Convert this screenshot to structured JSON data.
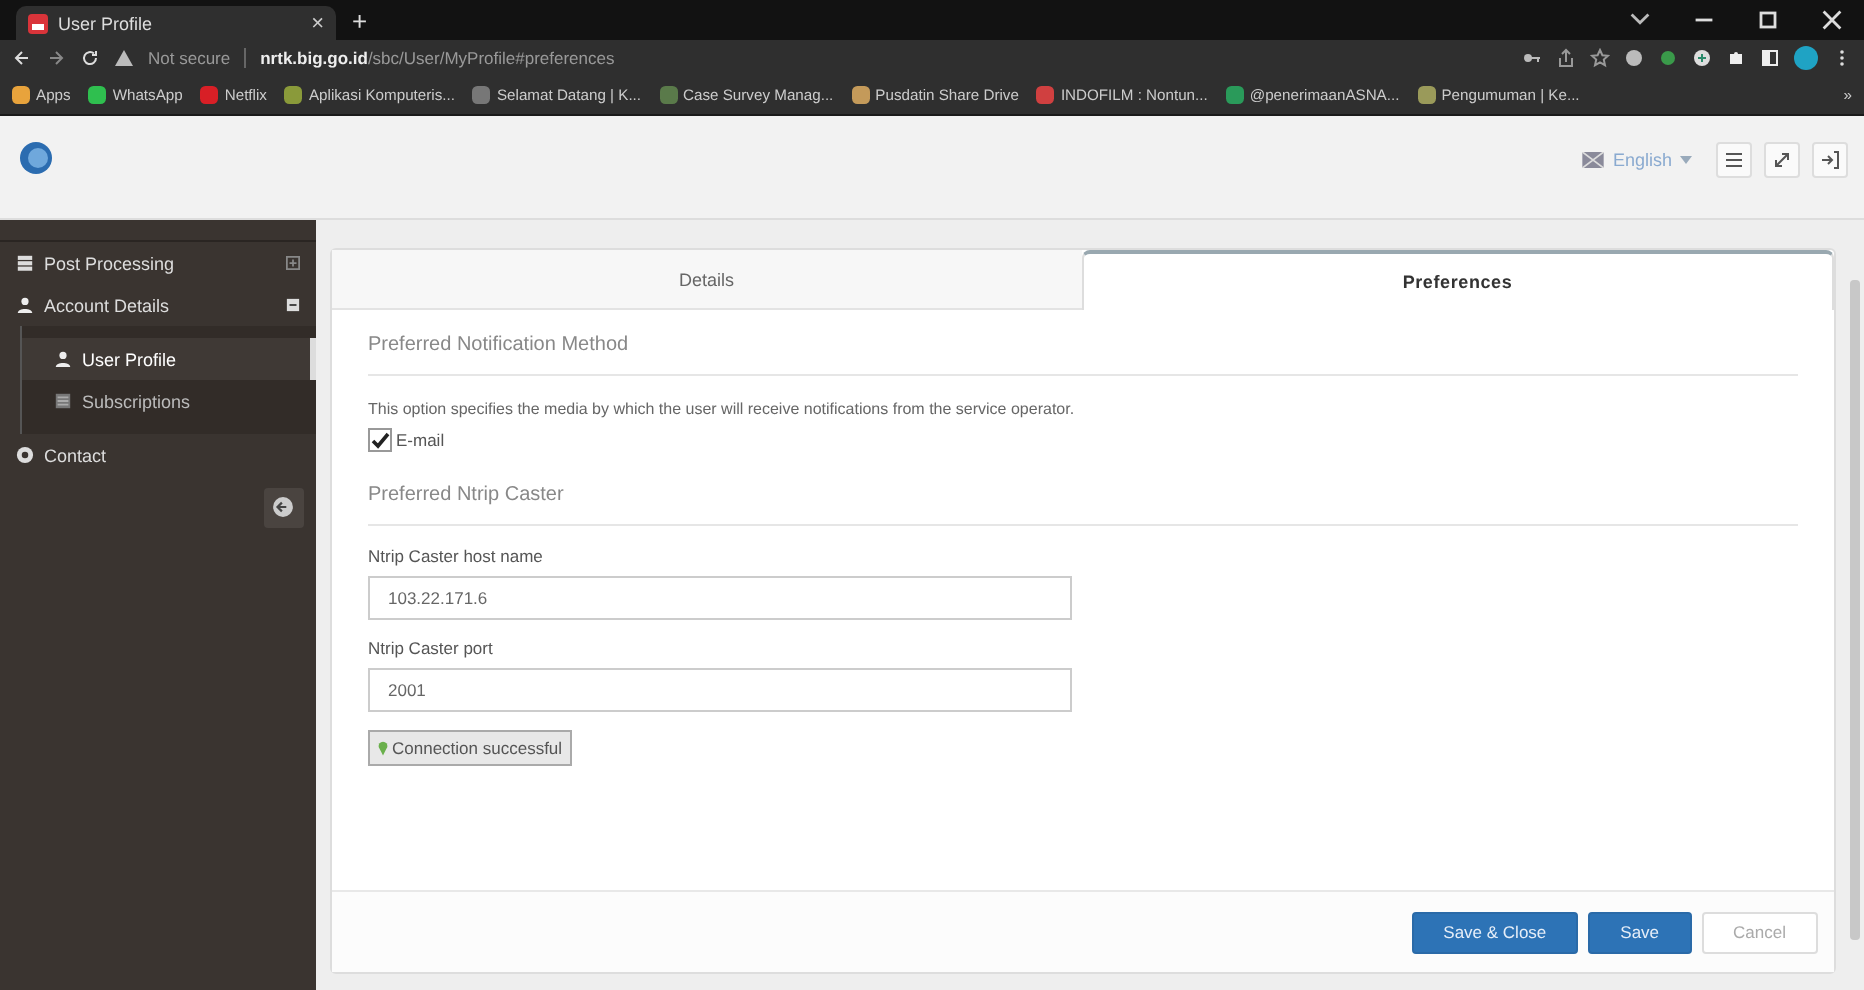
{
  "browser": {
    "tab_title": "User Profile",
    "tab_close": "×",
    "new_tab": "+",
    "security": "Not secure",
    "url": "**nrtk.big.go.id**/sbc/User/MyProfile#preferences",
    "bookmarks": [
      {
        "label": "Apps",
        "color": "#e8a33c"
      },
      {
        "label": "WhatsApp",
        "color": "#2fbf4f"
      },
      {
        "label": "Netflix",
        "color": "#d81f26"
      },
      {
        "label": "Aplikasi Komputeris...",
        "color": "#8a9a3a"
      },
      {
        "label": "Selamat Datang | K...",
        "color": "#777777"
      },
      {
        "label": "Case Survey Manag...",
        "color": "#5a7a4a"
      },
      {
        "label": "Pusdatin Share Drive",
        "color": "#c49a5a"
      },
      {
        "label": "INDOFILM : Nontun...",
        "color": "#d04040"
      },
      {
        "label": "@penerimaanASNA...",
        "color": "#2a9a5a"
      },
      {
        "label": "Pengumuman | Ke...",
        "color": "#9a9a5a"
      }
    ],
    "more": "»"
  },
  "header": {
    "language": "English"
  },
  "sidebar": {
    "items": [
      {
        "label": "Post Processing",
        "kind": "stack",
        "expanded": false,
        "selected": false
      },
      {
        "label": "Account Details",
        "kind": "user",
        "expanded": true,
        "selected": false,
        "children": [
          {
            "label": "User Profile",
            "kind": "user",
            "selected": true
          },
          {
            "label": "Subscriptions",
            "kind": "list",
            "selected": false
          }
        ]
      },
      {
        "label": "Contact",
        "kind": "circle",
        "selected": false
      }
    ]
  },
  "tabs": [
    {
      "label": "Details",
      "selected": false
    },
    {
      "label": "Preferences",
      "selected": true
    }
  ],
  "notification": {
    "heading": "Preferred Notification Method",
    "description": "This option specifies the media by which the user will receive notifications from the service operator.",
    "options": [
      {
        "label": "E-mail",
        "checked": true
      }
    ]
  },
  "caster": {
    "heading": "Preferred Ntrip Caster",
    "fields": [
      {
        "label": "Ntrip Caster host name",
        "value": "103.22.171.6"
      },
      {
        "label": "Ntrip Caster port",
        "value": "2001"
      }
    ],
    "status": "Connection successful"
  },
  "buttons": [
    {
      "label": "Save & Close",
      "kind": "primary"
    },
    {
      "label": "Save",
      "kind": "primary"
    },
    {
      "label": "Cancel",
      "kind": "secondary"
    }
  ]
}
